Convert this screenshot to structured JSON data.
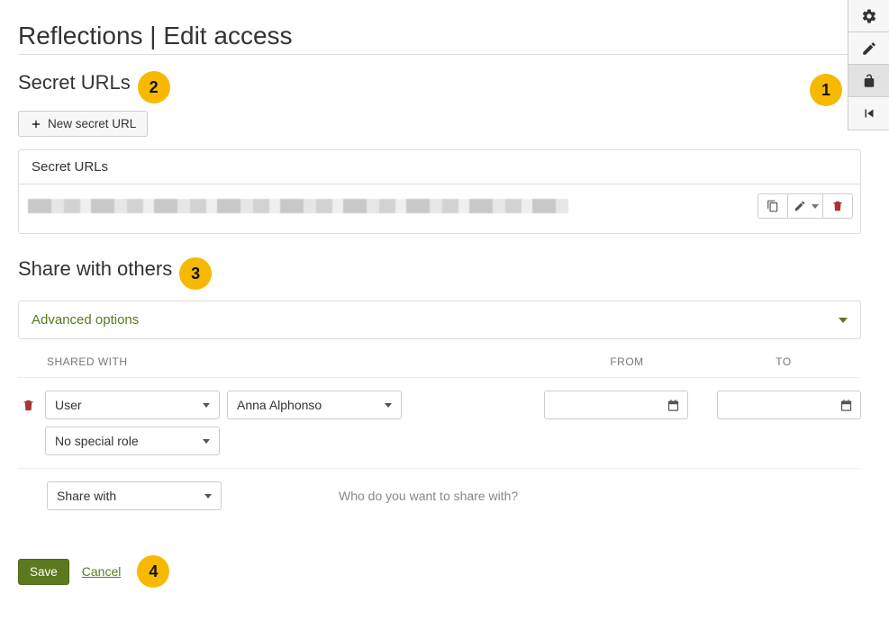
{
  "title": "Reflections | Edit access",
  "callouts": {
    "c1": "1",
    "c2": "2",
    "c3": "3",
    "c4": "4"
  },
  "rail": {
    "items": [
      {
        "name": "settings-icon"
      },
      {
        "name": "edit-icon"
      },
      {
        "name": "unlock-icon",
        "active": true
      },
      {
        "name": "first-icon"
      }
    ]
  },
  "secret_urls": {
    "heading": "Secret URLs",
    "new_btn": "New secret URL",
    "panel_header": "Secret URLs"
  },
  "share": {
    "heading": "Share with others",
    "advanced_label": "Advanced options",
    "headers": {
      "shared_with": "SHARED WITH",
      "from": "FROM",
      "to": "TO"
    },
    "row": {
      "type": "User",
      "person": "Anna Alphonso",
      "role": "No special role",
      "from": "",
      "to": ""
    },
    "placeholder": {
      "select_label": "Share with",
      "hint": "Who do you want to share with?"
    }
  },
  "footer": {
    "save": "Save",
    "cancel": "Cancel"
  }
}
